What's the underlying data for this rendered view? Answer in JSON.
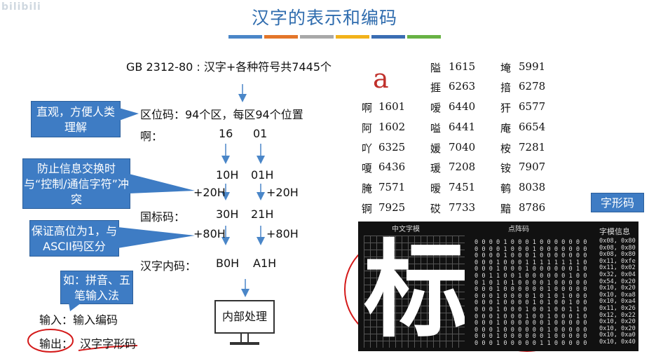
{
  "watermark": "bilibili",
  "title": "汉字的表示和编码",
  "accent_bars": [
    "#4a86c8",
    "#e3762a",
    "#a8a8a8",
    "#f2b21a",
    "#3a6db3",
    "#68b244"
  ],
  "left": {
    "gb_line": "GB 2312-80 : 汉字+各种符号共7445个",
    "quwei_label": "区位码：94个区，每区94个位置",
    "example_char": "啊：",
    "q1": "16",
    "q2": "01",
    "hex1": "10H",
    "hex2": "01H",
    "add20a": "+20H",
    "add20b": "+20H",
    "guobiao_label": "国标码：",
    "gb1": "30H",
    "gb2": "21H",
    "add80a": "+80H",
    "add80b": "+80H",
    "neima_label": "汉字内码：",
    "nm1": "B0H",
    "nm2": "A1H",
    "input_line": "输入：输入编码",
    "output_label": "输出：",
    "output_value": "汉字字形码",
    "process_box": "内部处理"
  },
  "callouts": {
    "c1": "直观，方便人类理解",
    "c2": "防止信息交换时与“控制/通信字符”冲突",
    "c3": "保证高位为1，与ASCII码区分",
    "c4": "如：拼音、五笔输入法",
    "glyph": "字形码"
  },
  "big_letter": "a",
  "code_table": [
    [
      "",
      "",
      "隘",
      "1615",
      "埯",
      "5991"
    ],
    [
      "",
      "",
      "捱",
      "6263",
      "揞",
      "6278"
    ],
    [
      "啊",
      "1601",
      "嗳",
      "6440",
      "犴",
      "6577"
    ],
    [
      "阿",
      "1602",
      "嗌",
      "6441",
      "庵",
      "6654"
    ],
    [
      "吖",
      "6325",
      "媛",
      "7040",
      "桉",
      "7281"
    ],
    [
      "嗄",
      "6436",
      "瑗",
      "7208",
      "铵",
      "7907"
    ],
    [
      "腌",
      "7571",
      "暧",
      "7451",
      "鹌",
      "8038"
    ],
    [
      "锕",
      "7925",
      "砹",
      "7733",
      "黯",
      "8786"
    ]
  ],
  "panel": {
    "h1": "中文字模",
    "h2": "点阵码",
    "h3": "字模信息",
    "glyph_char": "标",
    "bit_rows": [
      "0 0 0 0 1 0 0 0 1 0 0 0 0 0 0 0",
      "0 0 0 0 1 0 0 0 1 0 0 0 0 0 0 0",
      "0 0 0 0 1 0 0 0 1 0 0 0 0 0 0 0",
      "0 0 0 1 0 0 0 1 1 1 1 1 1 1 1 0",
      "0 0 0 1 0 0 0 1 0 0 0 0 0 0 1 0",
      "0 0 1 1 0 0 1 0 0 0 0 0 0 1 0 0",
      "0 1 0 1 0 1 0 0 0 0 1 0 0 0 0 0",
      "0 0 0 1 0 0 0 0 0 0 1 0 0 0 0 0",
      "0 0 0 1 0 0 0 0 1 0 1 0 1 0 0 0",
      "0 0 0 1 0 0 0 0 1 0 1 0 0 1 0 0",
      "0 0 0 1 0 0 0 1 0 0 1 0 0 1 1 0",
      "0 0 0 1 0 0 0 1 0 0 1 0 0 0 1 0",
      "0 0 0 1 0 0 0 0 0 0 1 0 0 0 0 0",
      "0 0 0 1 0 0 0 0 0 0 1 0 0 0 0 0",
      "0 0 0 1 0 0 0 0 0 0 1 0 0 0 0 0",
      "0 0 0 1 0 0 0 0 0 1 1 0 0 0 0 0"
    ],
    "info_rows": [
      "0x08, 0x80",
      "0x08, 0x80",
      "0x08, 0x80",
      "0x11, 0xfe",
      "0x11, 0x02",
      "0x32, 0x04",
      "0x54, 0x20",
      "0x10, 0x20",
      "0x10, 0xa8",
      "0x10, 0xa4",
      "0x11, 0x26",
      "0x12, 0x22",
      "0x10, 0x20",
      "0x10, 0x20",
      "0x10, 0xa0",
      "0x10, 0x40"
    ]
  }
}
